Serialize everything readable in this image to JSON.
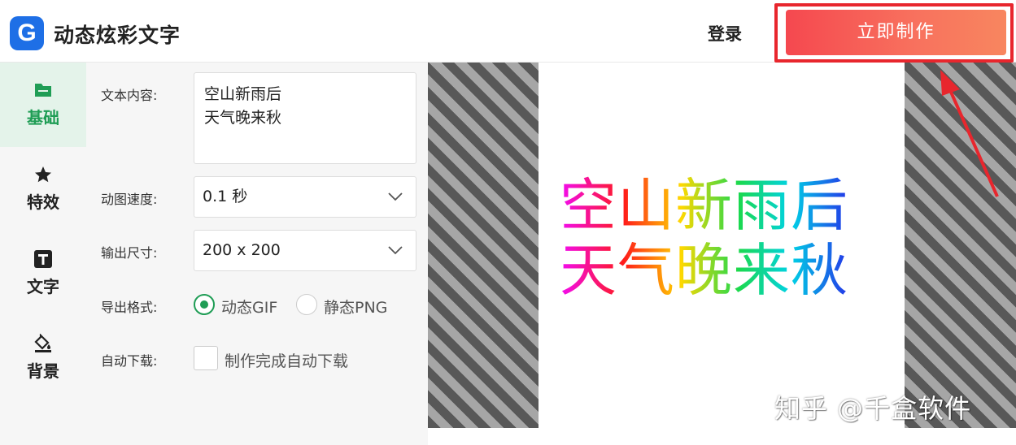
{
  "header": {
    "logo_letter": "G",
    "app_title": "动态炫彩文字",
    "login_label": "登录",
    "make_button_label": "立即制作"
  },
  "sidebar": {
    "items": [
      {
        "label": "基础",
        "icon": "folder-icon",
        "active": true
      },
      {
        "label": "特效",
        "icon": "star-icon",
        "active": false
      },
      {
        "label": "文字",
        "icon": "text-t-icon",
        "active": false
      },
      {
        "label": "背景",
        "icon": "paint-bucket-icon",
        "active": false
      }
    ]
  },
  "form": {
    "text_content_label": "文本内容:",
    "text_content_value": "空山新雨后\n天气晚来秋",
    "speed_label": "动图速度:",
    "speed_value": "0.1 秒",
    "size_label": "输出尺寸:",
    "size_value": "200 x 200",
    "format_label": "导出格式:",
    "format_options": [
      {
        "label": "动态GIF",
        "selected": true
      },
      {
        "label": "静态PNG",
        "selected": false
      }
    ],
    "auto_download_label": "自动下载:",
    "auto_download_option": "制作完成自动下载",
    "auto_download_checked": false
  },
  "preview": {
    "line1": "空山新雨后",
    "line2": "天气晚来秋",
    "gradient_colors": [
      "#f20cf2",
      "#ff1a1a",
      "#ffd800",
      "#1bd94e",
      "#00d2e6",
      "#2436e8"
    ]
  },
  "watermark": "知乎 @千盒软件",
  "colors": {
    "accent_green": "#1f9d55",
    "button_red": "#f5484f",
    "highlight_red": "#e8262d",
    "logo_blue": "#1e6fe6"
  }
}
